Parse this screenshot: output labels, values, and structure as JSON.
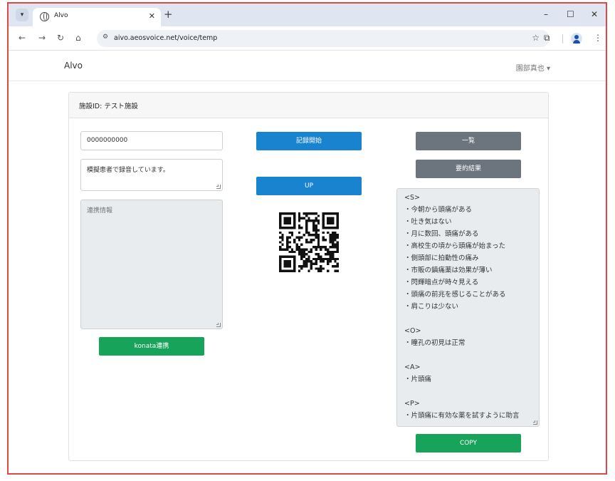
{
  "browser": {
    "tab_title": "Alvo",
    "url": "aivo.aeosvoice.net/voice/temp"
  },
  "app": {
    "brand": "Alvo",
    "user_name": "園部真也 ▾"
  },
  "card": {
    "header": "施設ID: テスト施設"
  },
  "left": {
    "id_value": "0000000000",
    "status_value": "模擬患者で録音しています。",
    "integration_placeholder": "連携情報",
    "konata_button": "konata連携"
  },
  "middle": {
    "record_button": "記録開始",
    "up_button": "UP"
  },
  "right": {
    "list_button": "一覧",
    "summary_button": "要約結果",
    "copy_button": "COPY",
    "summary_lines": [
      "<S>",
      "・今朝から頭痛がある",
      "・吐き気はない",
      "・月に数回、頭痛がある",
      "・高校生の頃から頭痛が始まった",
      "・側頭部に拍動性の痛み",
      "・市販の鎮痛薬は効果が薄い",
      "・閃輝暗点が時々見える",
      "・頭痛の前兆を感じることがある",
      "・肩こりは少ない",
      "",
      "<O>",
      "・瞳孔の初見は正常",
      "",
      "<A>",
      "・片頭痛",
      "",
      "<P>",
      "・片頭痛に有効な薬を試すように助言"
    ]
  },
  "colors": {
    "primary": "#1a83d0",
    "secondary": "#6c757d",
    "success": "#18a35a",
    "frame_border": "#e04848"
  }
}
